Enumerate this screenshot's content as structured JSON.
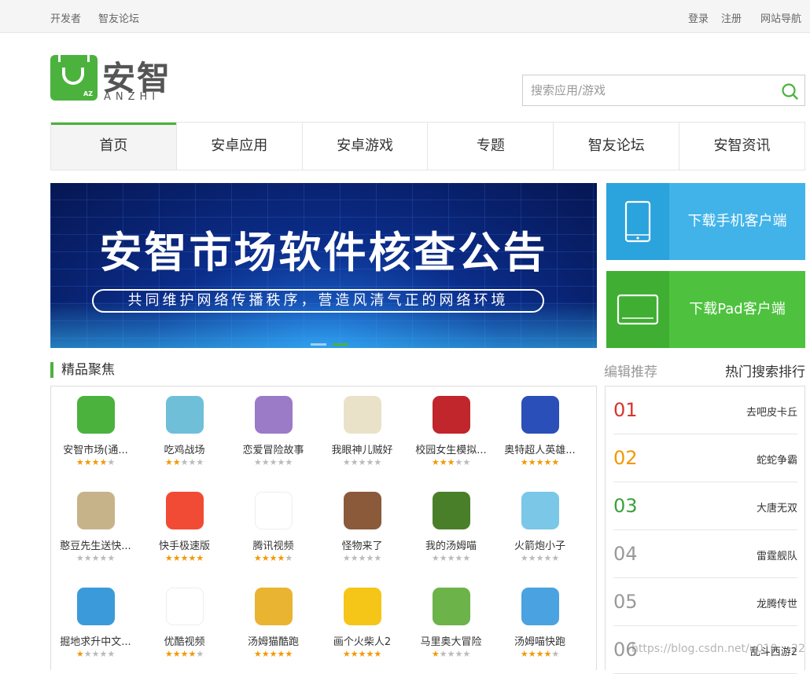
{
  "topbar": {
    "links_left": [
      "开发者",
      "智友论坛"
    ],
    "links_right": [
      "登录",
      "注册",
      "网站导航"
    ]
  },
  "logo": {
    "cn": "安智",
    "en": "ANZHI",
    "badge": "AZ"
  },
  "search": {
    "placeholder": "搜索应用/游戏",
    "icon": "search-icon"
  },
  "nav": {
    "tabs": [
      "首页",
      "安卓应用",
      "安卓游戏",
      "专题",
      "智友论坛",
      "安智资讯"
    ],
    "active": "首页"
  },
  "banner": {
    "title": "安智市场软件核查公告",
    "subtitle": "共同维护网络传播秩序，营造风清气正的网络环境",
    "slide_count": 2,
    "active_slide": 2
  },
  "download": {
    "phone_label": "下载手机客户端",
    "pad_label": "下载Pad客户端"
  },
  "featured": {
    "title": "精品聚焦",
    "apps": [
      {
        "name": "安智市场(通...",
        "rating": 4,
        "icon": "anzhi-market-icon",
        "color": "#4bb23e"
      },
      {
        "name": "吃鸡战场",
        "rating": 2,
        "icon": "battleground-icon",
        "color": "#6fbfd9"
      },
      {
        "name": "恋爱冒险故事",
        "rating": 0,
        "icon": "love-story-icon",
        "color": "#9b7ac8"
      },
      {
        "name": "我眼神儿贼好",
        "rating": 0,
        "icon": "magnifier-game-icon",
        "color": "#e9e2c9"
      },
      {
        "name": "校园女生模拟...",
        "rating": 2.5,
        "icon": "school-girl-icon",
        "color": "#c0262b"
      },
      {
        "name": "奥特超人英雄...",
        "rating": 5,
        "icon": "ultraman-icon",
        "color": "#2b4fb8"
      },
      {
        "name": "憨豆先生送快...",
        "rating": 0,
        "icon": "mr-bean-icon",
        "color": "#c7b38a"
      },
      {
        "name": "快手极速版",
        "rating": 4.5,
        "icon": "kuaishou-icon",
        "color": "#f24b35"
      },
      {
        "name": "腾讯视频",
        "rating": 4,
        "icon": "tencent-video-icon",
        "color": "#ffffff"
      },
      {
        "name": "怪物来了",
        "rating": 0,
        "icon": "monster-icon",
        "color": "#8a5a3a"
      },
      {
        "name": "我的汤姆喵",
        "rating": 0,
        "icon": "talking-tom-icon",
        "color": "#4a7f2a"
      },
      {
        "name": "火箭炮小子",
        "rating": 0,
        "icon": "rocket-kid-icon",
        "color": "#7ac7e8"
      },
      {
        "name": "掘地求升中文...",
        "rating": 1,
        "icon": "getting-over-it-icon",
        "color": "#3b9ad9"
      },
      {
        "name": "优酷视频",
        "rating": 4,
        "icon": "youku-icon",
        "color": "#ffffff"
      },
      {
        "name": "汤姆猫酷跑",
        "rating": 5,
        "icon": "tom-gold-run-icon",
        "color": "#e9b431"
      },
      {
        "name": "画个火柴人2",
        "rating": 5,
        "icon": "draw-stickman-icon",
        "color": "#f5c518"
      },
      {
        "name": "马里奥大冒险",
        "rating": 1,
        "icon": "mario-adventure-icon",
        "color": "#6cb34a"
      },
      {
        "name": "汤姆喵快跑",
        "rating": 4,
        "icon": "tom-run-icon",
        "color": "#4aa3e0"
      }
    ]
  },
  "right": {
    "tabs": [
      "编辑推荐",
      "热门搜索排行"
    ],
    "ranking": [
      {
        "num": "01",
        "name": "去吧皮卡丘",
        "color": "#d9342b"
      },
      {
        "num": "02",
        "name": "蛇蛇争霸",
        "color": "#f39800"
      },
      {
        "num": "03",
        "name": "大唐无双",
        "color": "#3aa23a"
      },
      {
        "num": "04",
        "name": "雷霆舰队",
        "color": "#999999"
      },
      {
        "num": "05",
        "name": "龙腾传世",
        "color": "#999999"
      },
      {
        "num": "06",
        "name": "乱斗西游2",
        "color": "#999999"
      }
    ]
  },
  "watermark": "https://blog.csdn.net/u010... 22"
}
